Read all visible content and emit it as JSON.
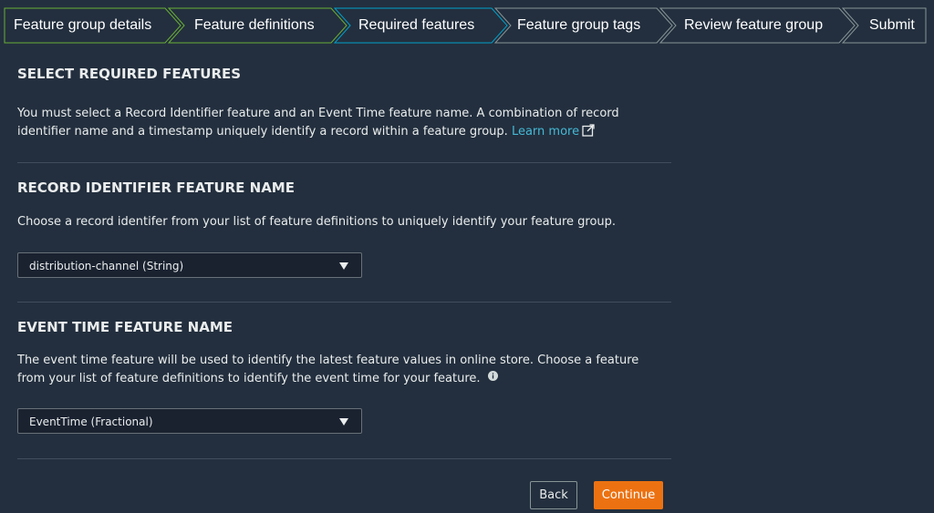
{
  "stepper": {
    "steps": [
      {
        "label": "Feature group details",
        "state": "completed"
      },
      {
        "label": "Feature definitions",
        "state": "completed"
      },
      {
        "label": "Required features",
        "state": "current"
      },
      {
        "label": "Feature group tags",
        "state": "upcoming"
      },
      {
        "label": "Review feature group",
        "state": "upcoming"
      },
      {
        "label": "Submit",
        "state": "upcoming"
      }
    ],
    "colors": {
      "completed_border": "#6aaf35",
      "current_border": "#00a1c9",
      "upcoming_border": "#879596"
    }
  },
  "select_required": {
    "title": "SELECT REQUIRED FEATURES",
    "description": "You must select a Record Identifier feature and an Event Time feature name. A combination of record identifier name and a timestamp uniquely identify a record within a feature group.",
    "learn_more": "Learn more",
    "learn_more_icon": "external-link-icon"
  },
  "record_identifier": {
    "title": "RECORD IDENTIFIER FEATURE NAME",
    "description": "Choose a record identifer from your list of feature definitions to uniquely identify your feature group.",
    "selected_value": "distribution-channel (String)"
  },
  "event_time": {
    "title": "EVENT TIME FEATURE NAME",
    "description": "The event time feature will be used to identify the latest feature values in online store. Choose a feature from your list of feature definitions to identify the event time for your feature.",
    "info_icon": "info-icon",
    "selected_value": "EventTime (Fractional)"
  },
  "actions": {
    "back_label": "Back",
    "continue_label": "Continue",
    "primary_color": "#ec7211"
  }
}
